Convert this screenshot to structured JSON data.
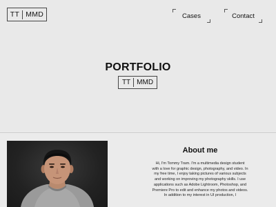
{
  "header": {
    "logo_left": "TT",
    "logo_right": "MMD",
    "nav": [
      {
        "label": "Cases"
      },
      {
        "label": "Contact"
      }
    ]
  },
  "hero": {
    "title": "PORTFOLIO",
    "logo_left": "TT",
    "logo_right": "MMD"
  },
  "about": {
    "title": "About me",
    "text": "Hi, I'm Tommy Tram. I'm a multimedia design student with a love for graphic design, photography, and video. In my free time, I enjoy taking pictures of various subjects and working on improving my photography skills. I use applications such as Adobe Lightroom, Photoshop, and Premiere Pro to edit and enhance my photos and videos. In addition to my interest in UI production, I"
  },
  "colors": {
    "background": "#e9e9e9",
    "text": "#111111",
    "photo_background": "#222222"
  }
}
